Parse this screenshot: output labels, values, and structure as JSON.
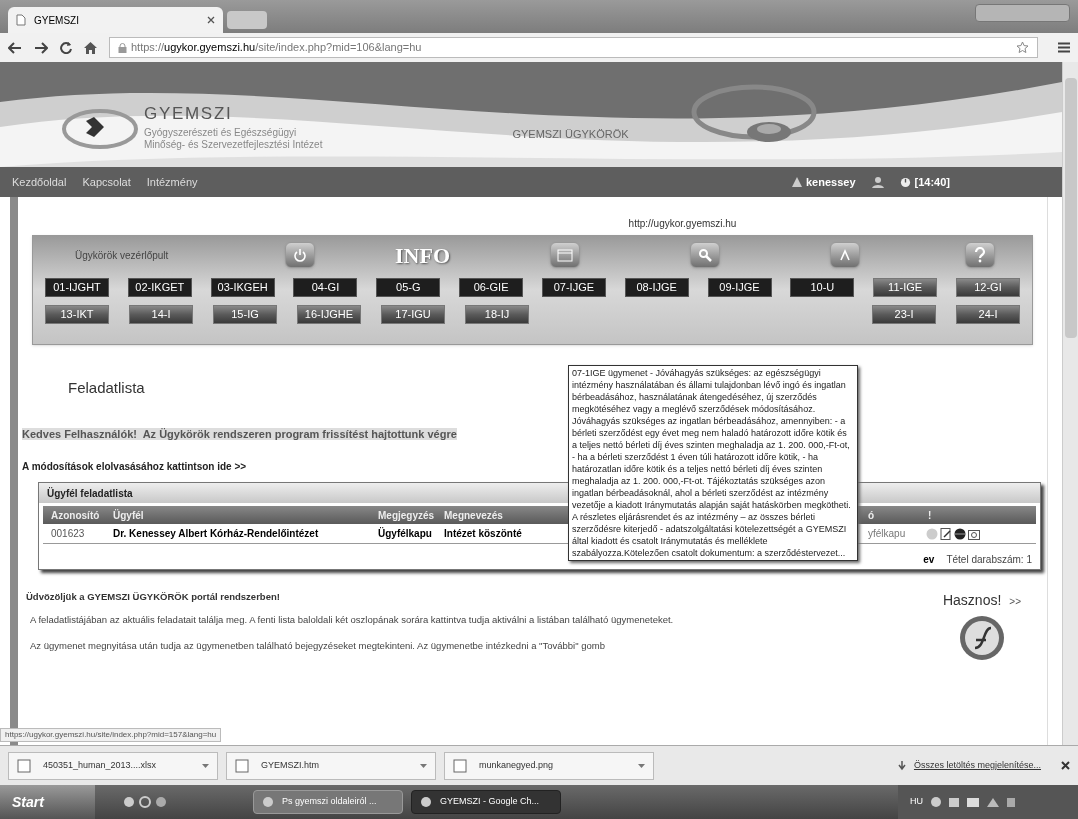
{
  "browser": {
    "tab_title": "GYEMSZI",
    "url_scheme": "https://",
    "url_host": "ugykor.gyemszi.hu",
    "url_path": "/site/index.php?mid=106&lang=hu"
  },
  "header": {
    "org_name": "GYEMSZI",
    "org_line1": "Gyógyszerészeti és Egészségügyi",
    "org_line2": "Minőség- és Szervezetfejlesztési Intézet",
    "portal_title": "GYEMSZI ÜGYKÖRÖK"
  },
  "nav": {
    "items": [
      "Kezdőoldal",
      "Kapcsolat",
      "Intézmény"
    ],
    "user": "kenessey",
    "time": "[14:40]"
  },
  "site_url": "http://ugykor.gyemszi.hu",
  "panel": {
    "title": "Ügykörök vezérlőpult",
    "info": "INFO",
    "row1": [
      {
        "label": "01-IJGHT",
        "available": true
      },
      {
        "label": "02-IKGET",
        "available": true
      },
      {
        "label": "03-IKGEH",
        "available": true
      },
      {
        "label": "04-GI",
        "available": true
      },
      {
        "label": "05-G",
        "available": true
      },
      {
        "label": "06-GIE",
        "available": true
      },
      {
        "label": "07-IJGE",
        "available": true
      },
      {
        "label": "08-IJGE",
        "available": true
      },
      {
        "label": "09-IJGE",
        "available": true
      },
      {
        "label": "10-U",
        "available": true
      },
      {
        "label": "11-IGE",
        "available": false
      },
      {
        "label": "12-GI",
        "available": false
      }
    ],
    "row2_left": [
      {
        "label": "13-IKT",
        "available": false
      },
      {
        "label": "14-I",
        "available": false
      },
      {
        "label": "15-IG",
        "available": false
      },
      {
        "label": "16-IJGHE",
        "available": false
      },
      {
        "label": "17-IGU",
        "available": false
      },
      {
        "label": "18-IJ",
        "available": false
      }
    ],
    "row2_right": [
      {
        "label": "23-I",
        "available": false
      },
      {
        "label": "24-I",
        "available": false
      }
    ]
  },
  "tooltip": "07-1IGE ügymenet - Jóváhagyás szükséges: az egészségügyi intézmény használatában és állami tulajdonban lévő ingó és ingatlan bérbeadásához, használatának átengedéséhez, új szerződés megkötéséhez vagy a meglévő szerződések módosításához. Jóváhagyás szükséges az ingatlan bérbeadásához, amennyiben: - a bérleti szerződést egy évet meg nem haladó határozott időre kötik és a teljes nettó bérleti díj éves szinten meghaladja az 1. 200. 000,-Ft-ot, - ha a bérleti szerződést 1 éven túli határozott időre kötik, - ha határozatlan időre kötik és a teljes nettó bérleti díj éves szinten meghaladja az 1. 200. 000,-Ft-ot. Tájékoztatás szükséges azon ingatlan bérbeadásoknál, ahol a bérleti szerződést az intézmény vezetője a kiadott Iránymutatás alapján saját hatáskörben megkötheti. A részletes eljárásrendet és az intézmény – az összes bérleti szerződésre kiterjedő - adatszolgáltatási kötelezettségét a GYEMSZI által kiadott és csatolt Iránymutatás és melléklete szabályozza.Kötelezően csatolt dokumentum: a szerződéstervezet...",
  "tasks": {
    "title": "Feladatlista",
    "announcement": "Kedves Felhasználók!  Az Ügykörök rendszeren program frissítést hajtottunk végre",
    "changes_link": "A módosítások elolvasásához kattintson ide >>",
    "table_title": "Ügyfél feladatlista",
    "columns": [
      "Azonosító",
      "Ügyfél",
      "Megjegyzés",
      "Megnevezés",
      "ó",
      "!"
    ],
    "rows": [
      {
        "id": "001623",
        "client": "Dr. Kenessey Albert Kórház-Rendelőintézet",
        "note": "Ügyfélkapu",
        "name": "Intézet köszönté",
        "column_5": "yfélkapu"
      }
    ],
    "footer_left": "ev",
    "count": "Tétel darabszám: 1"
  },
  "welcome": {
    "title": "Üdvözöljük a GYEMSZI ÜGYKÖRÖK portál rendszerben!",
    "paragraph": "A feladatlistájában az aktuális feladatait találja meg. A fenti lista baloldali két oszlopának sorára kattintva tudja aktiválni a listában található ügymeneteket.",
    "next_line": "Az ügymenet megnyitása után tudja az ügymenetben található bejegyzéseket megtekinteni. Az ügymenetbe intézkedni a \"További\" gomb"
  },
  "useful": {
    "title": "Hasznos!",
    "more": ">>"
  },
  "status_url": "https://ugykor.gyemszi.hu/site/index.php?mid=157&lang=hu",
  "downloads": {
    "items": [
      "450351_human_2013....xlsx",
      "GYEMSZI.htm",
      "munkanegyed.png"
    ],
    "show_all": "Összes letöltés megjelenítése..."
  },
  "taskbar": {
    "start": "Start",
    "windows": [
      {
        "label": "Ps gyemszi oldaleiról ...",
        "selected": false
      },
      {
        "label": "GYEMSZI - Google Ch...",
        "selected": true
      }
    ],
    "lang": "HU"
  }
}
